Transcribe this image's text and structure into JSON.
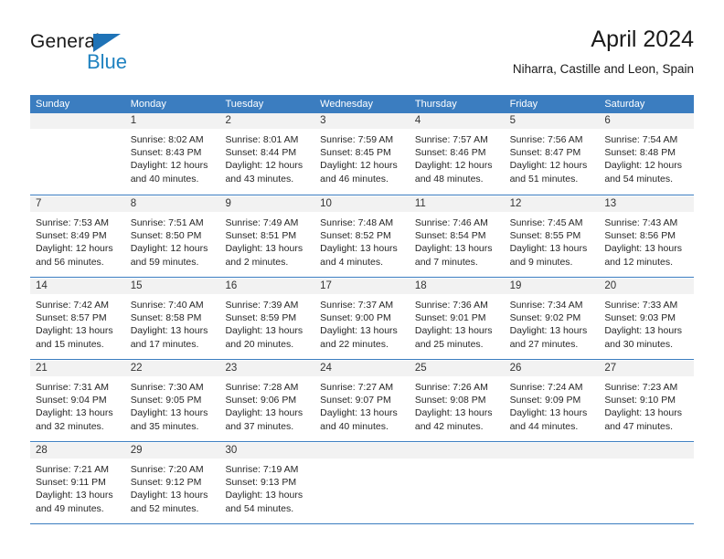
{
  "brand": {
    "name_part1": "General",
    "name_part2": "Blue",
    "accent_color": "#1f82c0",
    "triangle_color": "#1f73b7"
  },
  "header": {
    "title": "April 2024",
    "subtitle": "Niharra, Castille and Leon, Spain"
  },
  "theme": {
    "header_bar_color": "#3b7dc0",
    "day_strip_color": "#f2f2f2",
    "text_color": "#262626"
  },
  "weekdays": [
    "Sunday",
    "Monday",
    "Tuesday",
    "Wednesday",
    "Thursday",
    "Friday",
    "Saturday"
  ],
  "weeks": [
    [
      {
        "day": "",
        "sunrise": "",
        "sunset": "",
        "daylight_line1": "",
        "daylight_line2": "",
        "empty": true
      },
      {
        "day": "1",
        "sunrise": "Sunrise: 8:02 AM",
        "sunset": "Sunset: 8:43 PM",
        "daylight_line1": "Daylight: 12 hours",
        "daylight_line2": "and 40 minutes."
      },
      {
        "day": "2",
        "sunrise": "Sunrise: 8:01 AM",
        "sunset": "Sunset: 8:44 PM",
        "daylight_line1": "Daylight: 12 hours",
        "daylight_line2": "and 43 minutes."
      },
      {
        "day": "3",
        "sunrise": "Sunrise: 7:59 AM",
        "sunset": "Sunset: 8:45 PM",
        "daylight_line1": "Daylight: 12 hours",
        "daylight_line2": "and 46 minutes."
      },
      {
        "day": "4",
        "sunrise": "Sunrise: 7:57 AM",
        "sunset": "Sunset: 8:46 PM",
        "daylight_line1": "Daylight: 12 hours",
        "daylight_line2": "and 48 minutes."
      },
      {
        "day": "5",
        "sunrise": "Sunrise: 7:56 AM",
        "sunset": "Sunset: 8:47 PM",
        "daylight_line1": "Daylight: 12 hours",
        "daylight_line2": "and 51 minutes."
      },
      {
        "day": "6",
        "sunrise": "Sunrise: 7:54 AM",
        "sunset": "Sunset: 8:48 PM",
        "daylight_line1": "Daylight: 12 hours",
        "daylight_line2": "and 54 minutes."
      }
    ],
    [
      {
        "day": "7",
        "sunrise": "Sunrise: 7:53 AM",
        "sunset": "Sunset: 8:49 PM",
        "daylight_line1": "Daylight: 12 hours",
        "daylight_line2": "and 56 minutes."
      },
      {
        "day": "8",
        "sunrise": "Sunrise: 7:51 AM",
        "sunset": "Sunset: 8:50 PM",
        "daylight_line1": "Daylight: 12 hours",
        "daylight_line2": "and 59 minutes."
      },
      {
        "day": "9",
        "sunrise": "Sunrise: 7:49 AM",
        "sunset": "Sunset: 8:51 PM",
        "daylight_line1": "Daylight: 13 hours",
        "daylight_line2": "and 2 minutes."
      },
      {
        "day": "10",
        "sunrise": "Sunrise: 7:48 AM",
        "sunset": "Sunset: 8:52 PM",
        "daylight_line1": "Daylight: 13 hours",
        "daylight_line2": "and 4 minutes."
      },
      {
        "day": "11",
        "sunrise": "Sunrise: 7:46 AM",
        "sunset": "Sunset: 8:54 PM",
        "daylight_line1": "Daylight: 13 hours",
        "daylight_line2": "and 7 minutes."
      },
      {
        "day": "12",
        "sunrise": "Sunrise: 7:45 AM",
        "sunset": "Sunset: 8:55 PM",
        "daylight_line1": "Daylight: 13 hours",
        "daylight_line2": "and 9 minutes."
      },
      {
        "day": "13",
        "sunrise": "Sunrise: 7:43 AM",
        "sunset": "Sunset: 8:56 PM",
        "daylight_line1": "Daylight: 13 hours",
        "daylight_line2": "and 12 minutes."
      }
    ],
    [
      {
        "day": "14",
        "sunrise": "Sunrise: 7:42 AM",
        "sunset": "Sunset: 8:57 PM",
        "daylight_line1": "Daylight: 13 hours",
        "daylight_line2": "and 15 minutes."
      },
      {
        "day": "15",
        "sunrise": "Sunrise: 7:40 AM",
        "sunset": "Sunset: 8:58 PM",
        "daylight_line1": "Daylight: 13 hours",
        "daylight_line2": "and 17 minutes."
      },
      {
        "day": "16",
        "sunrise": "Sunrise: 7:39 AM",
        "sunset": "Sunset: 8:59 PM",
        "daylight_line1": "Daylight: 13 hours",
        "daylight_line2": "and 20 minutes."
      },
      {
        "day": "17",
        "sunrise": "Sunrise: 7:37 AM",
        "sunset": "Sunset: 9:00 PM",
        "daylight_line1": "Daylight: 13 hours",
        "daylight_line2": "and 22 minutes."
      },
      {
        "day": "18",
        "sunrise": "Sunrise: 7:36 AM",
        "sunset": "Sunset: 9:01 PM",
        "daylight_line1": "Daylight: 13 hours",
        "daylight_line2": "and 25 minutes."
      },
      {
        "day": "19",
        "sunrise": "Sunrise: 7:34 AM",
        "sunset": "Sunset: 9:02 PM",
        "daylight_line1": "Daylight: 13 hours",
        "daylight_line2": "and 27 minutes."
      },
      {
        "day": "20",
        "sunrise": "Sunrise: 7:33 AM",
        "sunset": "Sunset: 9:03 PM",
        "daylight_line1": "Daylight: 13 hours",
        "daylight_line2": "and 30 minutes."
      }
    ],
    [
      {
        "day": "21",
        "sunrise": "Sunrise: 7:31 AM",
        "sunset": "Sunset: 9:04 PM",
        "daylight_line1": "Daylight: 13 hours",
        "daylight_line2": "and 32 minutes."
      },
      {
        "day": "22",
        "sunrise": "Sunrise: 7:30 AM",
        "sunset": "Sunset: 9:05 PM",
        "daylight_line1": "Daylight: 13 hours",
        "daylight_line2": "and 35 minutes."
      },
      {
        "day": "23",
        "sunrise": "Sunrise: 7:28 AM",
        "sunset": "Sunset: 9:06 PM",
        "daylight_line1": "Daylight: 13 hours",
        "daylight_line2": "and 37 minutes."
      },
      {
        "day": "24",
        "sunrise": "Sunrise: 7:27 AM",
        "sunset": "Sunset: 9:07 PM",
        "daylight_line1": "Daylight: 13 hours",
        "daylight_line2": "and 40 minutes."
      },
      {
        "day": "25",
        "sunrise": "Sunrise: 7:26 AM",
        "sunset": "Sunset: 9:08 PM",
        "daylight_line1": "Daylight: 13 hours",
        "daylight_line2": "and 42 minutes."
      },
      {
        "day": "26",
        "sunrise": "Sunrise: 7:24 AM",
        "sunset": "Sunset: 9:09 PM",
        "daylight_line1": "Daylight: 13 hours",
        "daylight_line2": "and 44 minutes."
      },
      {
        "day": "27",
        "sunrise": "Sunrise: 7:23 AM",
        "sunset": "Sunset: 9:10 PM",
        "daylight_line1": "Daylight: 13 hours",
        "daylight_line2": "and 47 minutes."
      }
    ],
    [
      {
        "day": "28",
        "sunrise": "Sunrise: 7:21 AM",
        "sunset": "Sunset: 9:11 PM",
        "daylight_line1": "Daylight: 13 hours",
        "daylight_line2": "and 49 minutes."
      },
      {
        "day": "29",
        "sunrise": "Sunrise: 7:20 AM",
        "sunset": "Sunset: 9:12 PM",
        "daylight_line1": "Daylight: 13 hours",
        "daylight_line2": "and 52 minutes."
      },
      {
        "day": "30",
        "sunrise": "Sunrise: 7:19 AM",
        "sunset": "Sunset: 9:13 PM",
        "daylight_line1": "Daylight: 13 hours",
        "daylight_line2": "and 54 minutes."
      },
      {
        "day": "",
        "sunrise": "",
        "sunset": "",
        "daylight_line1": "",
        "daylight_line2": "",
        "empty": true
      },
      {
        "day": "",
        "sunrise": "",
        "sunset": "",
        "daylight_line1": "",
        "daylight_line2": "",
        "empty": true
      },
      {
        "day": "",
        "sunrise": "",
        "sunset": "",
        "daylight_line1": "",
        "daylight_line2": "",
        "empty": true
      },
      {
        "day": "",
        "sunrise": "",
        "sunset": "",
        "daylight_line1": "",
        "daylight_line2": "",
        "empty": true
      }
    ]
  ]
}
